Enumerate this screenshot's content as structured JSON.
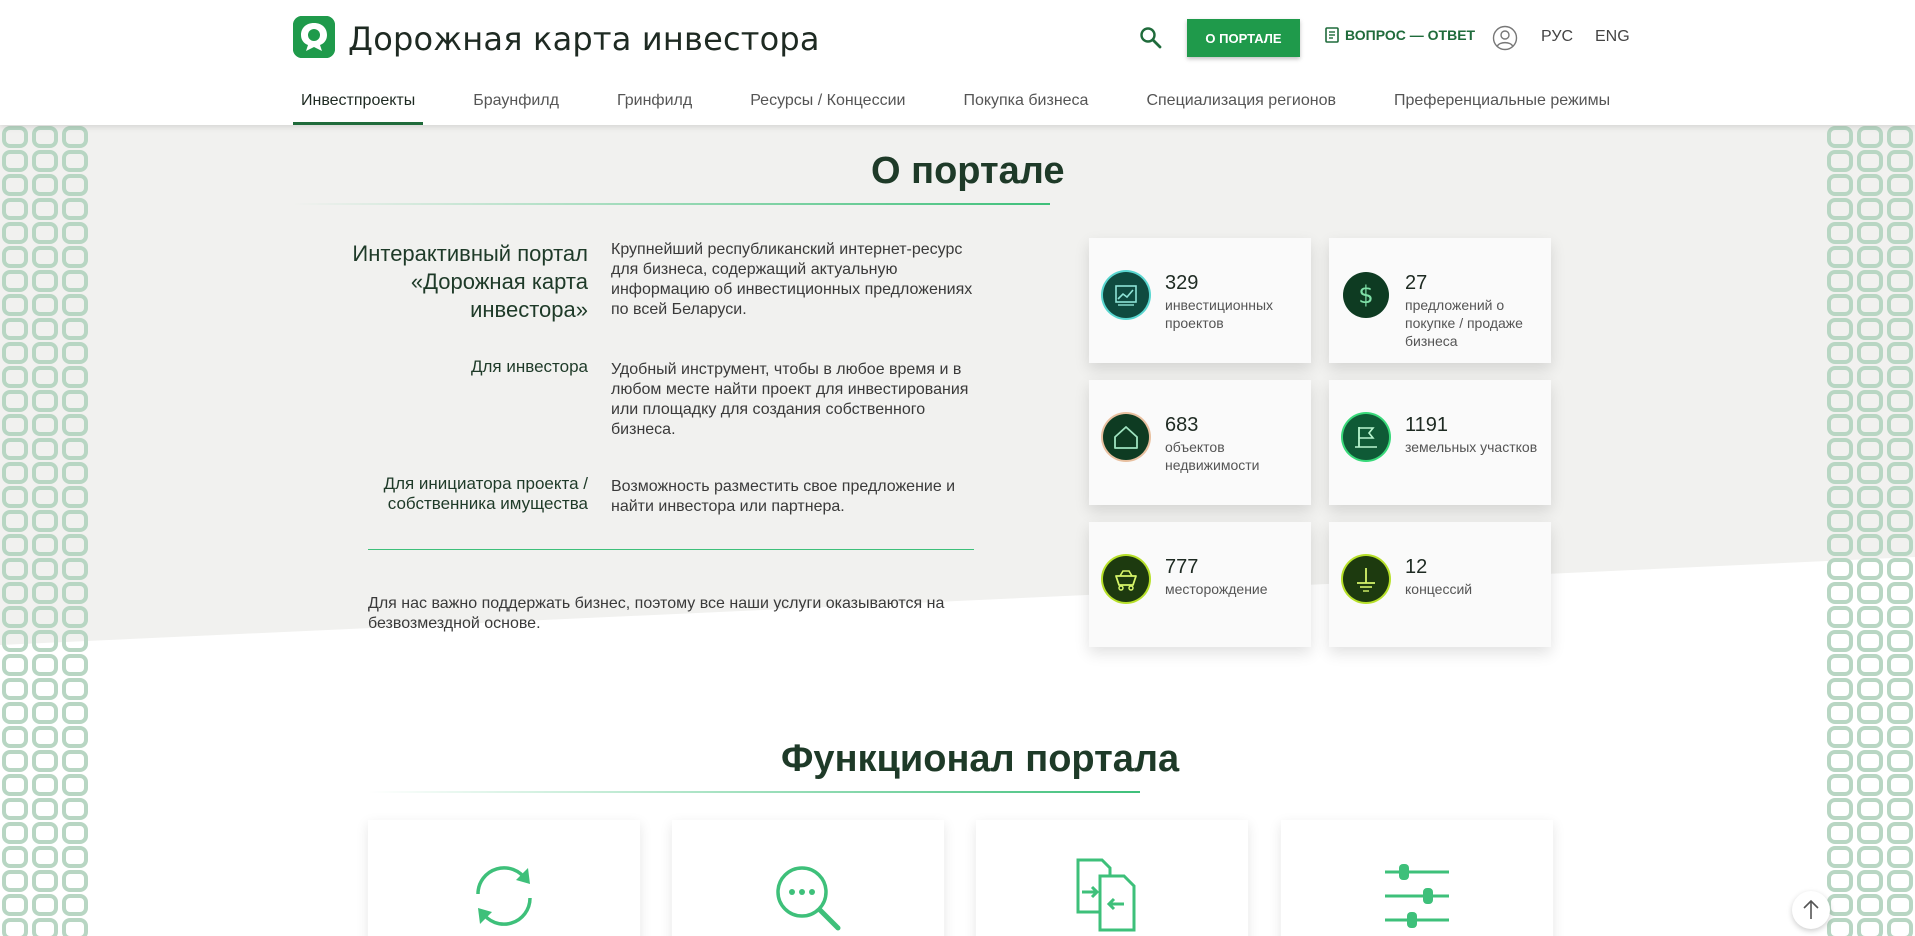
{
  "header": {
    "title": "Дорожная карта инвестора",
    "about_button": "О ПОРТАЛЕ",
    "qa_link": "ВОПРОС — ОТВЕТ",
    "lang_ru": "РУС",
    "lang_en": "ENG"
  },
  "nav": {
    "items": [
      {
        "label": "Инвестпроекты",
        "active": true
      },
      {
        "label": "Браунфилд"
      },
      {
        "label": "Гринфилд"
      },
      {
        "label": "Ресурсы / Концессии"
      },
      {
        "label": "Покупка бизнеса"
      },
      {
        "label": "Специализация регионов"
      },
      {
        "label": "Преференциальные режимы"
      }
    ]
  },
  "about": {
    "title": "О портале",
    "rows": [
      {
        "label": "Интерактивный портал «Дорожная карта инвестора»",
        "text": "Крупнейший республиканский интернет-ресурс для бизнеса, содержащий актуальную информацию об инвестиционных предложениях по всей Беларуси."
      },
      {
        "label": "Для инвестора",
        "text": "Удобный инструмент, чтобы в любое время и в любом месте найти проект для инвестирования или площадку для создания собственного бизнеса."
      },
      {
        "label": "Для инициатора проекта / собственника имущества",
        "text": "Возможность разместить свое предложение и найти инвестора или партнера."
      }
    ],
    "note": "Для нас важно поддержать бизнес, поэтому все наши услуги оказываются на безвозмездной основе."
  },
  "stats": [
    {
      "value": "329",
      "label": "инвестиционных проектов",
      "icon": "chart-icon"
    },
    {
      "value": "27",
      "label": "предложений о покупке / продаже бизнеса",
      "icon": "dollar-icon"
    },
    {
      "value": "683",
      "label": "объектов недвижимости",
      "icon": "house-icon"
    },
    {
      "value": "1191",
      "label": "земельных участков",
      "icon": "flag-icon"
    },
    {
      "value": "777",
      "label": "месторождение",
      "icon": "mine-cart-icon"
    },
    {
      "value": "12",
      "label": "концессий",
      "icon": "ground-icon"
    }
  ],
  "functional": {
    "title": "Функционал портала",
    "cards": [
      {
        "icon": "refresh-icon"
      },
      {
        "icon": "search-chat-icon"
      },
      {
        "icon": "document-exchange-icon"
      },
      {
        "icon": "sliders-icon"
      }
    ]
  },
  "colors": {
    "brand": "#1f9a4b",
    "dark_green": "#0e3b22",
    "accent_line": "#3ec07a"
  }
}
